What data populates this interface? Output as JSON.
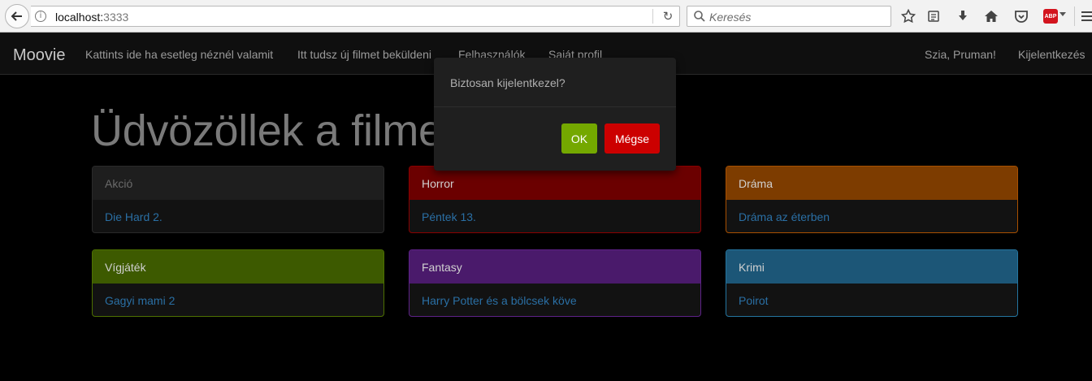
{
  "browser": {
    "url_host": "localhost:",
    "url_port": "3333",
    "search_placeholder": "Keresés",
    "abp_label": "ABP"
  },
  "navbar": {
    "brand": "Moovie",
    "links": [
      "Kattints ide ha esetleg néznél valamit",
      "Itt tudsz új filmet beküldeni",
      "Felhasználók",
      "Saját profil"
    ],
    "greeting": "Szia, Pruman!",
    "logout": "Kijelentkezés"
  },
  "hero": {
    "title": "Üdvözöllek a filmek világában!"
  },
  "categories": [
    {
      "name": "Akció",
      "movie": "Die Hard 2.",
      "color": "#1e1e1e"
    },
    {
      "name": "Horror",
      "movie": "Péntek 13.",
      "color": "#6b0000"
    },
    {
      "name": "Dráma",
      "movie": "Dráma az éterben",
      "color": "#7d3c00"
    },
    {
      "name": "Vígjáték",
      "movie": "Gagyi mami 2",
      "color": "#3d5a00"
    },
    {
      "name": "Fantasy",
      "movie": "Harry Potter és a bölcsek köve",
      "color": "#4a1a6b"
    },
    {
      "name": "Krimi",
      "movie": "Poirot",
      "color": "#1c5677"
    }
  ],
  "modal": {
    "message": "Biztosan kijelentkezel?",
    "ok_label": "OK",
    "cancel_label": "Mégse",
    "ok_color": "#74a800",
    "cancel_color": "#cc0000"
  }
}
